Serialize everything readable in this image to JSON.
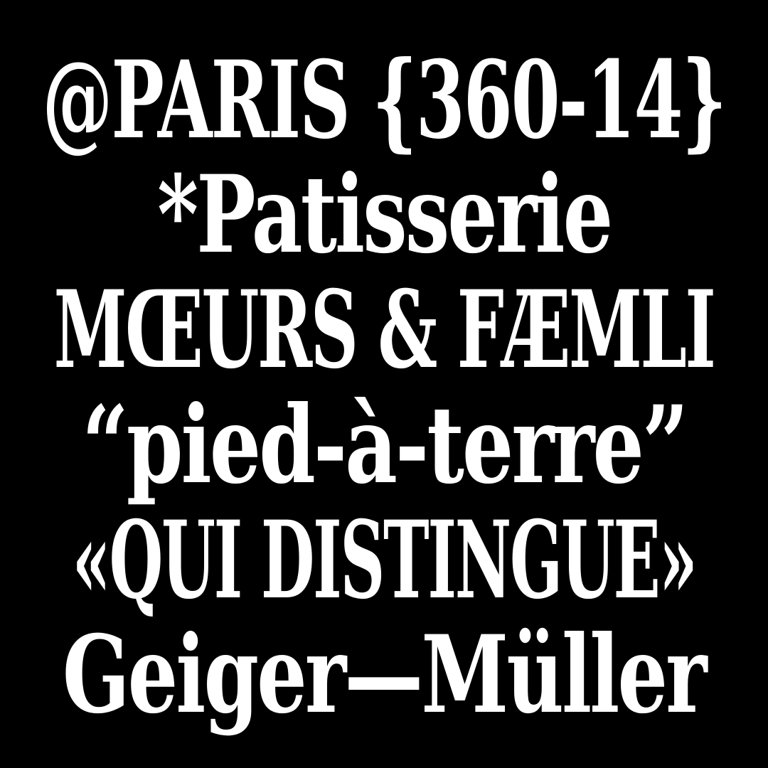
{
  "background_color": "#000000",
  "text_color": "#ffffff",
  "lines": [
    "@PARIS {360-14}",
    "*Patisserie",
    "MŒURS & FÆMLI",
    "“pied-à-terre”",
    "«QUI DISTINGUE»",
    "Geiger—Müller"
  ]
}
